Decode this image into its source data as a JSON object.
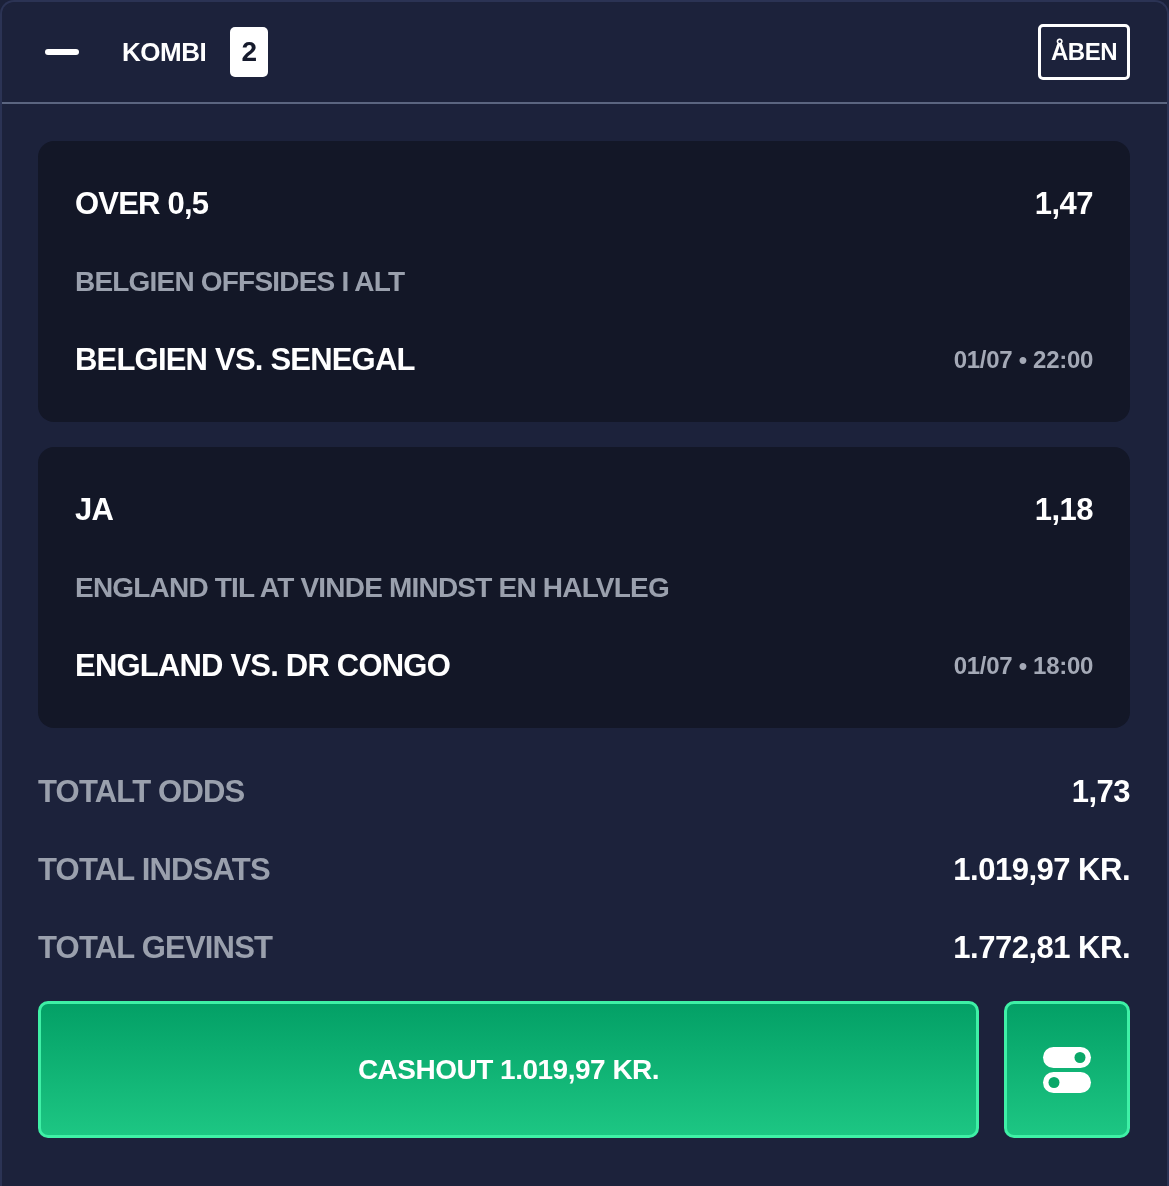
{
  "header": {
    "title": "KOMBI",
    "count": "2",
    "action": "ÅBEN"
  },
  "selections": [
    {
      "pick": "OVER 0,5",
      "odds": "1,47",
      "market": "BELGIEN OFFSIDES I ALT",
      "match": "BELGIEN VS. SENEGAL",
      "time": "01/07 • 22:00"
    },
    {
      "pick": "JA",
      "odds": "1,18",
      "market": "ENGLAND TIL AT VINDE MINDST EN HALVLEG",
      "match": "ENGLAND VS. DR CONGO",
      "time": "01/07 • 18:00"
    }
  ],
  "summary": [
    {
      "label": "TOTALT ODDS",
      "value": "1,73"
    },
    {
      "label": "TOTAL INDSATS",
      "value": "1.019,97 KR."
    },
    {
      "label": "TOTAL GEVINST",
      "value": "1.772,81 KR."
    }
  ],
  "cashout_button": "CASHOUT 1.019,97 KR."
}
